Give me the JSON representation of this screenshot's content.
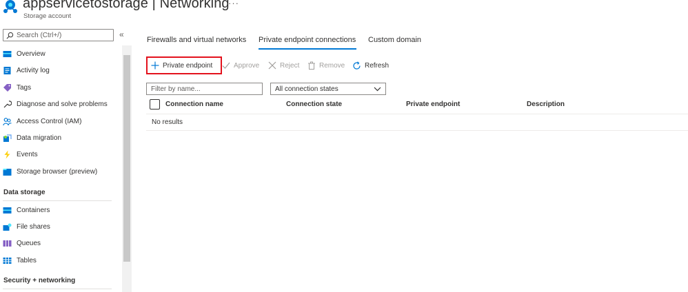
{
  "header": {
    "title": "appservicetostorage | Networking",
    "subtitle": "Storage account",
    "more": "···"
  },
  "sidebar": {
    "search_placeholder": "Search (Ctrl+/)",
    "collapse": "«",
    "items": [
      {
        "label": "Overview",
        "icon": "overview-icon"
      },
      {
        "label": "Activity log",
        "icon": "activity-log-icon"
      },
      {
        "label": "Tags",
        "icon": "tag-icon"
      },
      {
        "label": "Diagnose and solve problems",
        "icon": "wrench-icon"
      },
      {
        "label": "Access Control (IAM)",
        "icon": "people-icon"
      },
      {
        "label": "Data migration",
        "icon": "data-migration-icon"
      },
      {
        "label": "Events",
        "icon": "lightning-icon"
      },
      {
        "label": "Storage browser (preview)",
        "icon": "storage-browser-icon"
      }
    ],
    "section_data_storage": "Data storage",
    "data_storage_items": [
      {
        "label": "Containers",
        "icon": "containers-icon"
      },
      {
        "label": "File shares",
        "icon": "file-shares-icon"
      },
      {
        "label": "Queues",
        "icon": "queues-icon"
      },
      {
        "label": "Tables",
        "icon": "tables-icon"
      }
    ],
    "section_security": "Security + networking"
  },
  "tabs": [
    {
      "label": "Firewalls and virtual networks",
      "active": false
    },
    {
      "label": "Private endpoint connections",
      "active": true
    },
    {
      "label": "Custom domain",
      "active": false
    }
  ],
  "toolbar": {
    "private_endpoint": "Private endpoint",
    "approve": "Approve",
    "reject": "Reject",
    "remove": "Remove",
    "refresh": "Refresh"
  },
  "filters": {
    "name_placeholder": "Filter by name...",
    "state_selected": "All connection states"
  },
  "table": {
    "columns": [
      "Connection name",
      "Connection state",
      "Private endpoint",
      "Description"
    ],
    "empty_text": "No results"
  },
  "colors": {
    "accent": "#0078d4",
    "highlight": "#e3111c"
  }
}
